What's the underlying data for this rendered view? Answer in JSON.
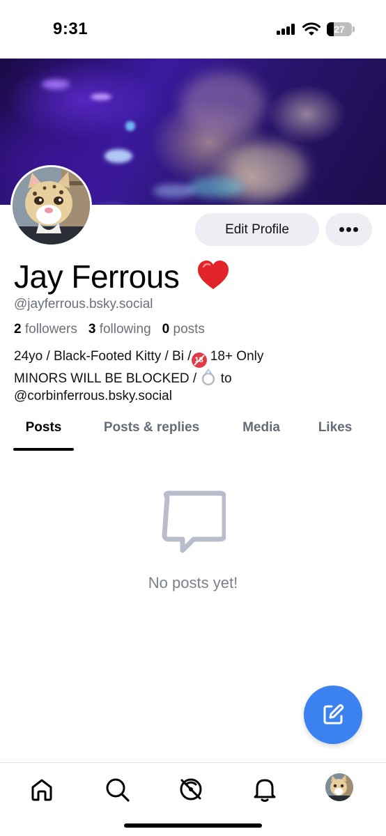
{
  "status_bar": {
    "time": "9:31",
    "battery": "27",
    "battery_level": 0.27
  },
  "profile": {
    "display_name": "Jay Ferrous",
    "handle": "@jayferrous.bsky.social",
    "followers_count": "2",
    "followers_label": "followers",
    "following_count": "3",
    "following_label": "following",
    "posts_count": "0",
    "posts_label": "posts",
    "bio": {
      "line1_a": "24yo / Black-Footed Kitty / Bi /",
      "line1_b": " 18+ Only",
      "line2_a": "MINORS WILL BE BLOCKED / ",
      "line2_b": " to",
      "line3": "@corbinferrous.bsky.social"
    }
  },
  "actions": {
    "edit_profile": "Edit Profile"
  },
  "tabs": [
    {
      "label": "Posts",
      "active": true
    },
    {
      "label": "Posts & replies",
      "active": false
    },
    {
      "label": "Media",
      "active": false
    },
    {
      "label": "Likes",
      "active": false
    }
  ],
  "empty_state": {
    "text": "No posts yet!"
  },
  "icons": {
    "heart": "red-heart-icon",
    "fab": "compose-icon",
    "nav": [
      "home-icon",
      "search-icon",
      "feeds-icon",
      "notifications-icon",
      "profile-avatar"
    ]
  },
  "colors": {
    "accent": "#3b82f0",
    "muted_text": "#6a6f7a",
    "button_bg": "#edeef3",
    "heart": "#e0242a"
  }
}
